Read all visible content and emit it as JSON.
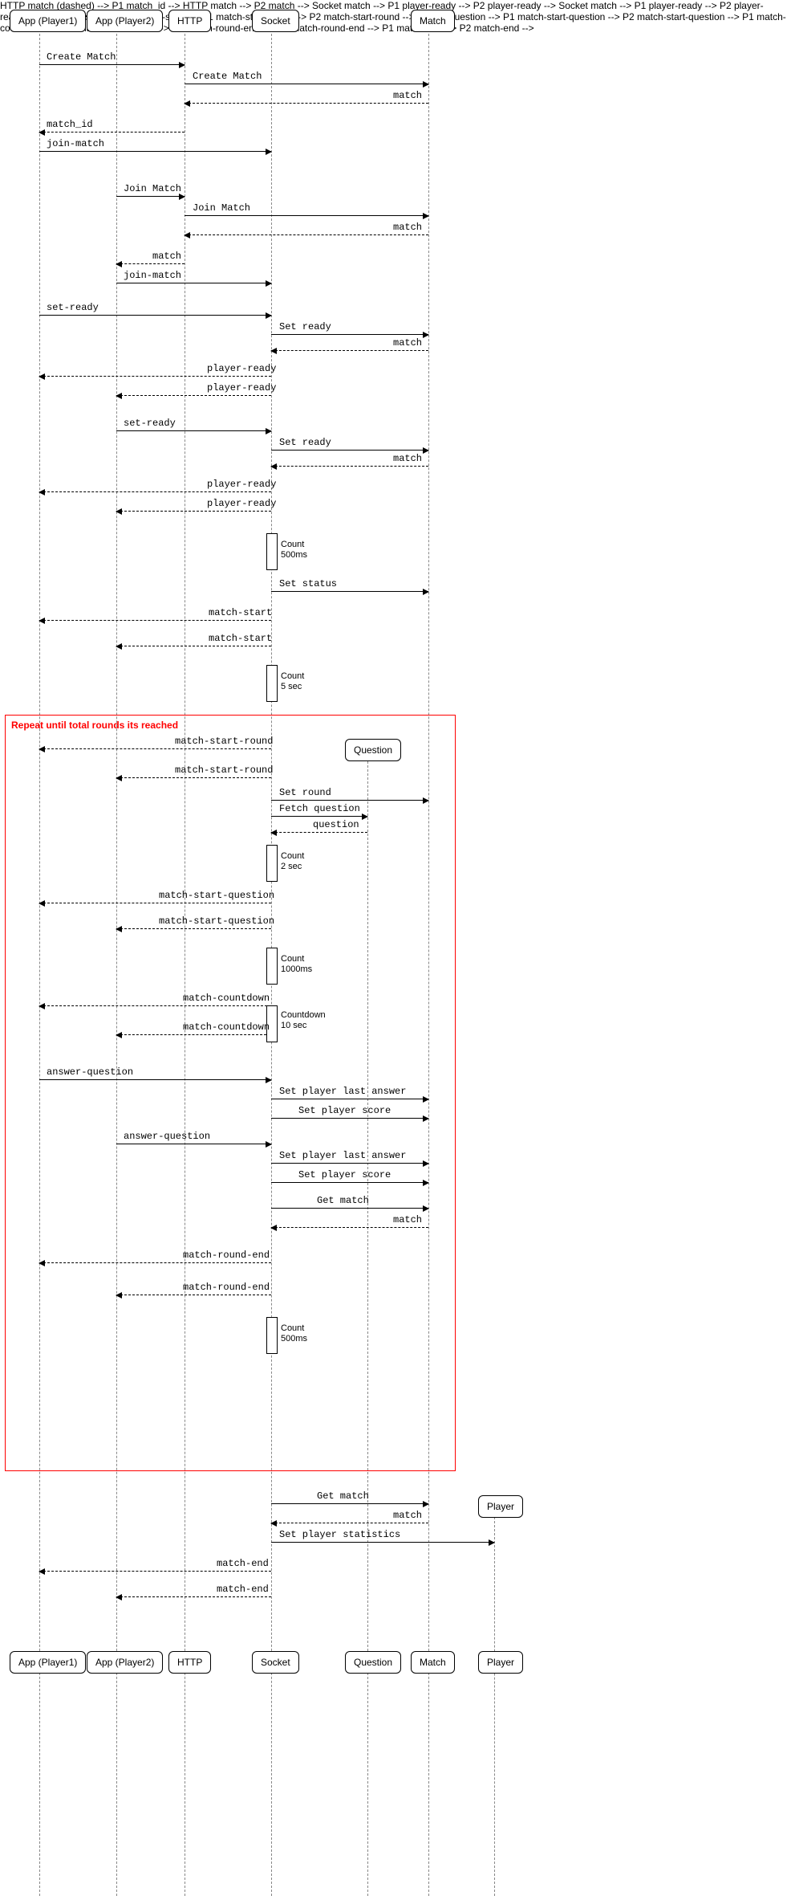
{
  "participants": {
    "p1": "App (Player1)",
    "p2": "App (Player2)",
    "http": "HTTP",
    "socket": "Socket",
    "match": "Match",
    "question": "Question",
    "player": "Player"
  },
  "loop_title": "Repeat until total rounds its reached",
  "messages": {
    "m1": "Create Match",
    "m2": "Create Match",
    "m3": "match",
    "m4": "match_id",
    "m5": "join-match",
    "m6": "Join Match",
    "m7": "Join Match",
    "m8": "match",
    "m9": "match",
    "m10": "join-match",
    "m11": "set-ready",
    "m12": "Set ready",
    "m13": "match",
    "m14": "player-ready",
    "m15": "player-ready",
    "m16": "set-ready",
    "m17": "Set ready",
    "m18": "match",
    "m19": "player-ready",
    "m20": "player-ready",
    "m21": "Set status",
    "m22": "match-start",
    "m23": "match-start",
    "m24": "match-start-round",
    "m25": "match-start-round",
    "m26": "Set round",
    "m27": "Fetch question",
    "m28": "question",
    "m29": "match-start-question",
    "m30": "match-start-question",
    "m31": "match-countdown",
    "m32": "match-countdown",
    "m33": "answer-question",
    "m34": "Set player last answer",
    "m35": "Set player score",
    "m36": "answer-question",
    "m37": "Set player last answer",
    "m38": "Set player score",
    "m39": "Get match",
    "m40": "match",
    "m41": "match-round-end",
    "m42": "match-round-end",
    "m43": "Get match",
    "m44": "match",
    "m45": "Set player statistics",
    "m46": "match-end",
    "m47": "match-end"
  },
  "notes": {
    "n1a": "Count",
    "n1b": "500ms",
    "n2a": "Count",
    "n2b": "5 sec",
    "n3a": "Count",
    "n3b": "2 sec",
    "n4a": "Count",
    "n4b": "1000ms",
    "n5a": "Countdown",
    "n5b": "10 sec",
    "n6a": "Count",
    "n6b": "500ms"
  },
  "chart_data": {
    "type": "sequence-diagram",
    "participants": [
      "App (Player1)",
      "App (Player2)",
      "HTTP",
      "Socket",
      "Match",
      "Question",
      "Player"
    ],
    "loop": {
      "condition": "Repeat until total rounds its reached",
      "start_after": "match-start (Count 5 sec)",
      "end_after": "match-round-end (Count 500ms)"
    },
    "events": [
      {
        "from": "App (Player1)",
        "to": "HTTP",
        "label": "Create Match",
        "type": "sync"
      },
      {
        "from": "HTTP",
        "to": "Match",
        "label": "Create Match",
        "type": "sync"
      },
      {
        "from": "Match",
        "to": "HTTP",
        "label": "match",
        "type": "return"
      },
      {
        "from": "HTTP",
        "to": "App (Player1)",
        "label": "match_id",
        "type": "return"
      },
      {
        "from": "App (Player1)",
        "to": "Socket",
        "label": "join-match",
        "type": "sync"
      },
      {
        "from": "App (Player2)",
        "to": "HTTP",
        "label": "Join Match",
        "type": "sync"
      },
      {
        "from": "HTTP",
        "to": "Match",
        "label": "Join Match",
        "type": "sync"
      },
      {
        "from": "Match",
        "to": "HTTP",
        "label": "match",
        "type": "return"
      },
      {
        "from": "HTTP",
        "to": "App (Player2)",
        "label": "match",
        "type": "return"
      },
      {
        "from": "App (Player2)",
        "to": "Socket",
        "label": "join-match",
        "type": "sync"
      },
      {
        "from": "App (Player1)",
        "to": "Socket",
        "label": "set-ready",
        "type": "sync"
      },
      {
        "from": "Socket",
        "to": "Match",
        "label": "Set ready",
        "type": "sync"
      },
      {
        "from": "Match",
        "to": "Socket",
        "label": "match",
        "type": "return"
      },
      {
        "from": "Socket",
        "to": "App (Player1)",
        "label": "player-ready",
        "type": "return"
      },
      {
        "from": "Socket",
        "to": "App (Player2)",
        "label": "player-ready",
        "type": "return"
      },
      {
        "from": "App (Player2)",
        "to": "Socket",
        "label": "set-ready",
        "type": "sync"
      },
      {
        "from": "Socket",
        "to": "Match",
        "label": "Set ready",
        "type": "sync"
      },
      {
        "from": "Match",
        "to": "Socket",
        "label": "match",
        "type": "return"
      },
      {
        "from": "Socket",
        "to": "App (Player1)",
        "label": "player-ready",
        "type": "return"
      },
      {
        "from": "Socket",
        "to": "App (Player2)",
        "label": "player-ready",
        "type": "return"
      },
      {
        "on": "Socket",
        "note": "Count 500ms"
      },
      {
        "from": "Socket",
        "to": "Match",
        "label": "Set status",
        "type": "sync"
      },
      {
        "from": "Socket",
        "to": "App (Player1)",
        "label": "match-start",
        "type": "return"
      },
      {
        "from": "Socket",
        "to": "App (Player2)",
        "label": "match-start",
        "type": "return"
      },
      {
        "on": "Socket",
        "note": "Count 5 sec"
      },
      {
        "loop_start": true
      },
      {
        "from": "Socket",
        "to": "App (Player1)",
        "label": "match-start-round",
        "type": "return"
      },
      {
        "from": "Socket",
        "to": "App (Player2)",
        "label": "match-start-round",
        "type": "return"
      },
      {
        "from": "Socket",
        "to": "Match",
        "label": "Set round",
        "type": "sync"
      },
      {
        "from": "Socket",
        "to": "Question",
        "label": "Fetch question",
        "type": "sync"
      },
      {
        "from": "Question",
        "to": "Socket",
        "label": "question",
        "type": "return"
      },
      {
        "on": "Socket",
        "note": "Count 2 sec"
      },
      {
        "from": "Socket",
        "to": "App (Player1)",
        "label": "match-start-question",
        "type": "return"
      },
      {
        "from": "Socket",
        "to": "App (Player2)",
        "label": "match-start-question",
        "type": "return"
      },
      {
        "on": "Socket",
        "note": "Count 1000ms"
      },
      {
        "from": "Socket",
        "to": "App (Player1)",
        "label": "match-countdown",
        "type": "return"
      },
      {
        "from": "Socket",
        "to": "App (Player2)",
        "label": "match-countdown",
        "type": "return"
      },
      {
        "on": "Socket",
        "note": "Countdown 10 sec"
      },
      {
        "from": "App (Player1)",
        "to": "Socket",
        "label": "answer-question",
        "type": "sync"
      },
      {
        "from": "Socket",
        "to": "Match",
        "label": "Set player last answer",
        "type": "sync"
      },
      {
        "from": "Socket",
        "to": "Match",
        "label": "Set player score",
        "type": "sync"
      },
      {
        "from": "App (Player2)",
        "to": "Socket",
        "label": "answer-question",
        "type": "sync"
      },
      {
        "from": "Socket",
        "to": "Match",
        "label": "Set player last answer",
        "type": "sync"
      },
      {
        "from": "Socket",
        "to": "Match",
        "label": "Set player score",
        "type": "sync"
      },
      {
        "from": "Socket",
        "to": "Match",
        "label": "Get match",
        "type": "sync"
      },
      {
        "from": "Match",
        "to": "Socket",
        "label": "match",
        "type": "return"
      },
      {
        "from": "Socket",
        "to": "App (Player1)",
        "label": "match-round-end",
        "type": "return"
      },
      {
        "from": "Socket",
        "to": "App (Player2)",
        "label": "match-round-end",
        "type": "return"
      },
      {
        "on": "Socket",
        "note": "Count 500ms"
      },
      {
        "loop_end": true
      },
      {
        "from": "Socket",
        "to": "Match",
        "label": "Get match",
        "type": "sync"
      },
      {
        "from": "Match",
        "to": "Socket",
        "label": "match",
        "type": "return"
      },
      {
        "from": "Socket",
        "to": "Player",
        "label": "Set player statistics",
        "type": "sync"
      },
      {
        "from": "Socket",
        "to": "App (Player1)",
        "label": "match-end",
        "type": "return"
      },
      {
        "from": "Socket",
        "to": "App (Player2)",
        "label": "match-end",
        "type": "return"
      }
    ]
  }
}
